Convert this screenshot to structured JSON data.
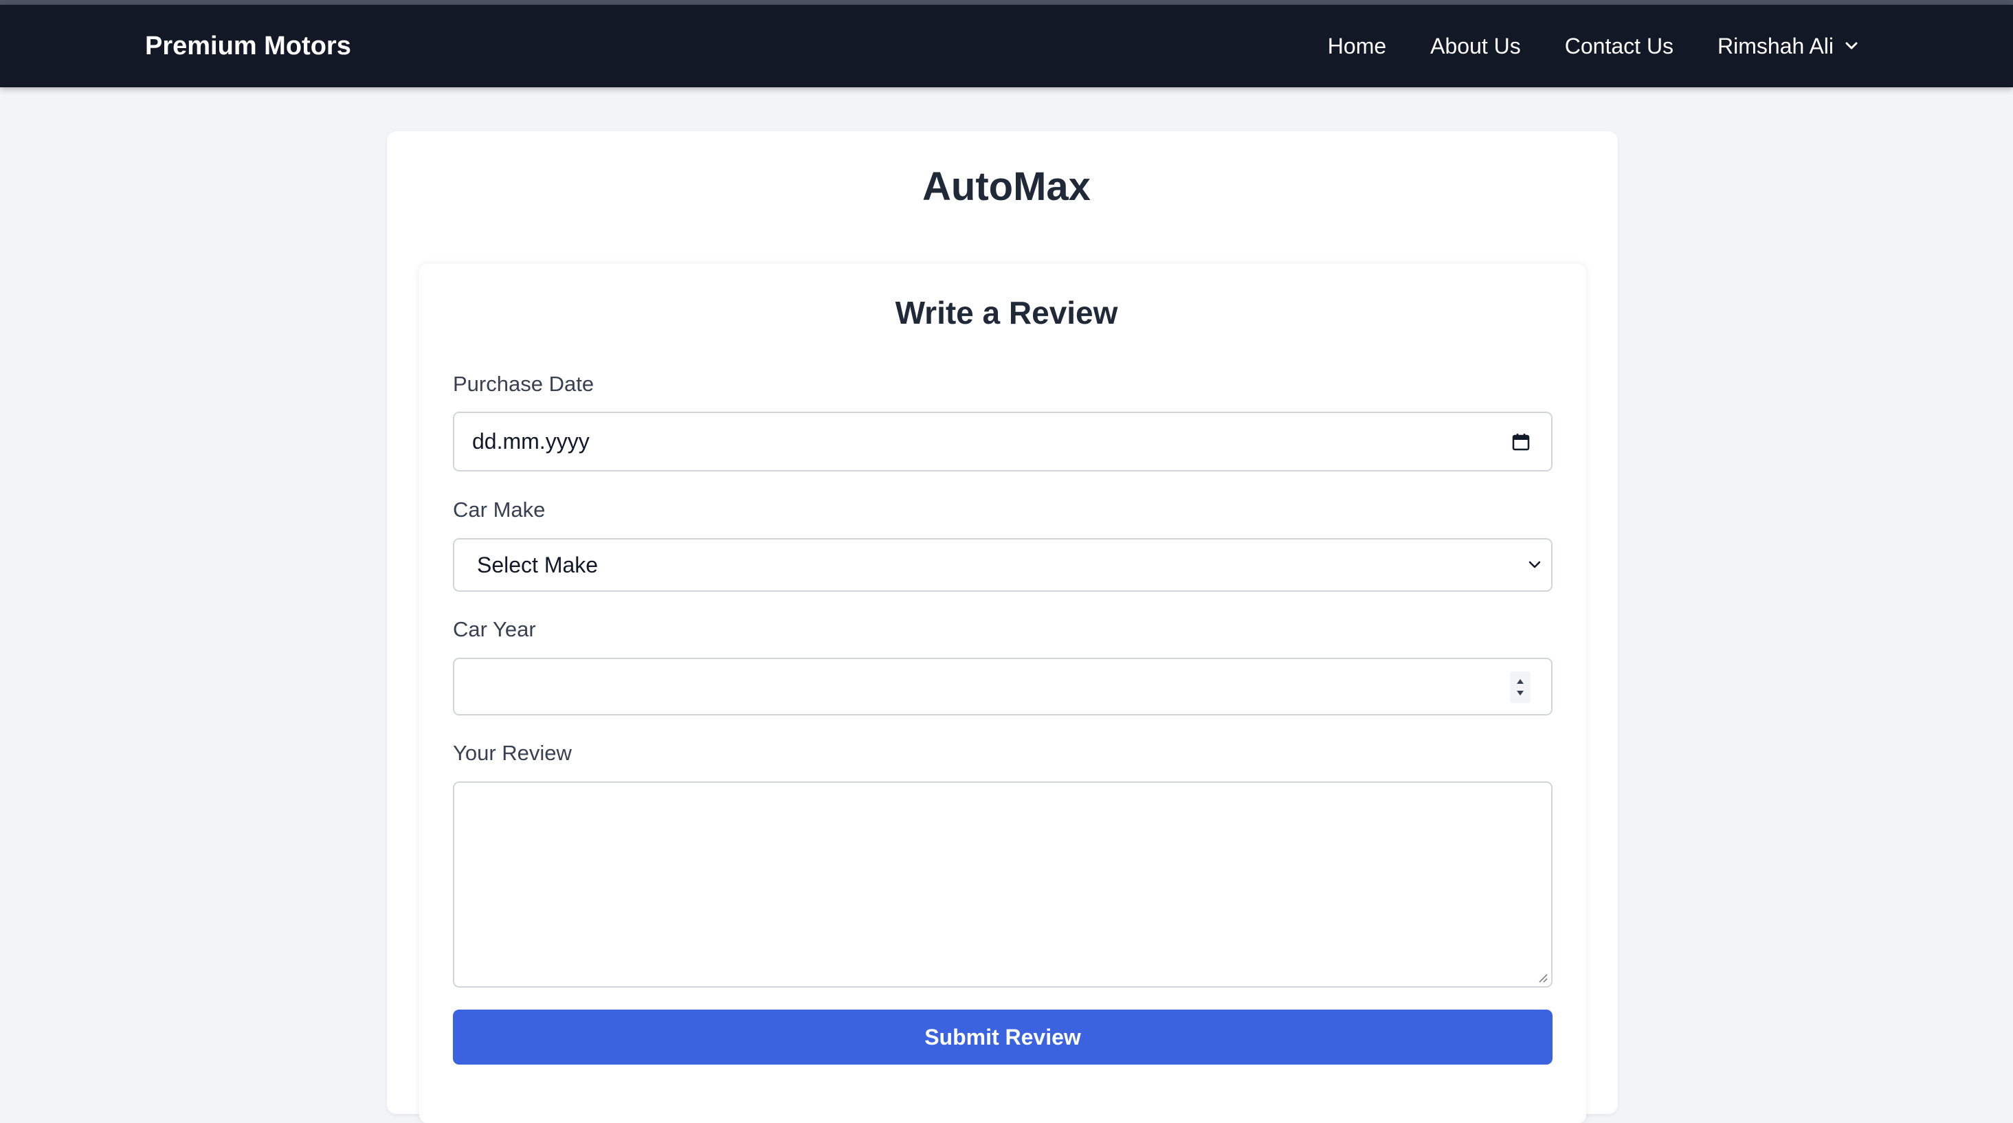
{
  "nav": {
    "brand": "Premium Motors",
    "links": [
      {
        "label": "Home"
      },
      {
        "label": "About Us"
      },
      {
        "label": "Contact Us"
      }
    ],
    "user": {
      "label": "Rimshah Ali",
      "icon": "chevron-down-icon"
    }
  },
  "page": {
    "title": "AutoMax"
  },
  "form": {
    "title": "Write a Review",
    "purchase_date": {
      "label": "Purchase Date",
      "placeholder": "dd.mm.yyyy",
      "icon": "calendar-icon"
    },
    "car_make": {
      "label": "Car Make",
      "selected": "Select Make",
      "icon": "chevron-down-icon"
    },
    "car_year": {
      "label": "Car Year",
      "value": ""
    },
    "review": {
      "label": "Your Review",
      "value": ""
    },
    "submit_label": "Submit Review"
  },
  "colors": {
    "navbar": "#121826",
    "background": "#f3f4f6",
    "primary_button": "#3b63e0"
  }
}
